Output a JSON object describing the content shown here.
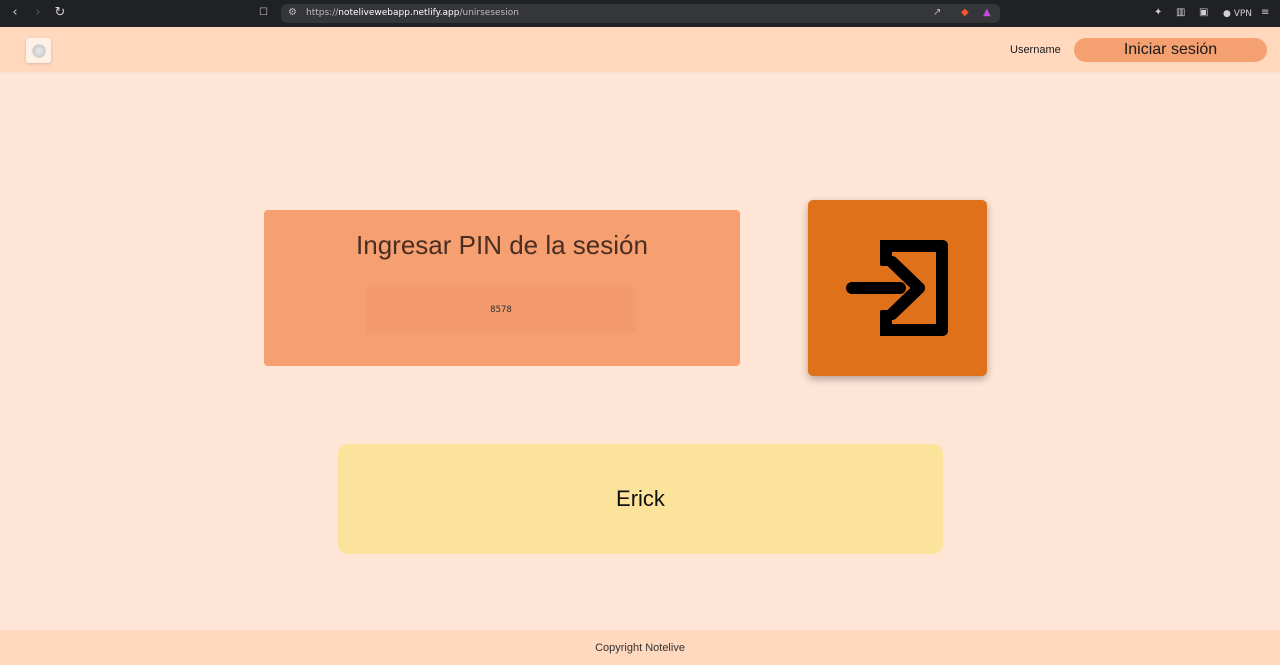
{
  "browser": {
    "url_prefix": "https://",
    "url_host": "notelivewebapp.netlify.app",
    "url_path": "/unirsesesion",
    "vpn_label": "VPN",
    "back_icon": "chevron-left-icon",
    "forward_icon": "chevron-right-icon",
    "reload_icon": "reload-icon"
  },
  "header": {
    "username": "Username",
    "login_label": "Iniciar sesión"
  },
  "pin_card": {
    "title": "Ingresar PIN de la sesión",
    "pin_value": "8578"
  },
  "join_button": {
    "icon": "login-icon"
  },
  "user_card": {
    "name": "Erick"
  },
  "footer": {
    "copyright": "Copyright Notelive"
  },
  "colors": {
    "background": "#fee5d6",
    "header": "#ffd8be",
    "accent": "#f5a070",
    "pin_card": "#f69f71",
    "join_button": "#e0711b",
    "user_card": "#fbe39c"
  }
}
